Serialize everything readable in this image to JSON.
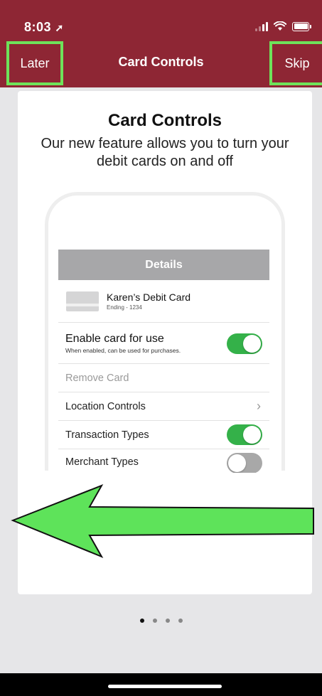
{
  "status": {
    "time": "8:03"
  },
  "nav": {
    "left_label": "Later",
    "title": "Card Controls",
    "right_label": "Skip"
  },
  "card": {
    "title": "Card Controls",
    "subtitle": "Our new feature allows you to turn your debit cards on and off"
  },
  "screen": {
    "header": "Details",
    "card_name": "Karen’s Debit Card",
    "card_ending": "Ending - 1234",
    "enable_title": "Enable card for use",
    "enable_desc": "When enabled, can be used for purchases.",
    "enable_on": true,
    "remove_label": "Remove Card",
    "location_label": "Location Controls",
    "transaction_label": "Transaction Types",
    "transaction_on": true,
    "merchant_label": "Merchant Types",
    "merchant_on": false
  },
  "pager": {
    "count": 4,
    "active": 0
  },
  "colors": {
    "brand": "#8e2634",
    "highlight": "#6ee35a",
    "toggle_on": "#34b149",
    "arrow": "#5ee35a"
  }
}
